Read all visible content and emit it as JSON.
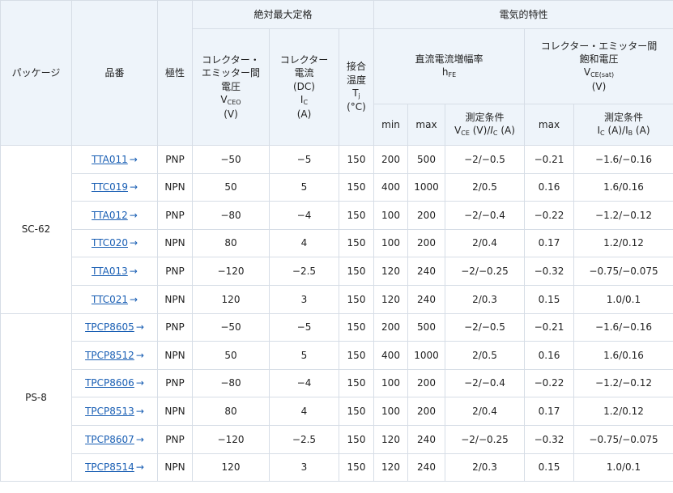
{
  "header": {
    "package": "パッケージ",
    "part": "品番",
    "polarity": "極性",
    "abs_max": "絶対最大定格",
    "elec": "電気的特性",
    "vceo": {
      "l1": "コレクター・",
      "l2": "エミッター間",
      "l3": "電圧",
      "sym": "V",
      "sub": "CEO",
      "unit": "(V)"
    },
    "ic": {
      "l1": "コレクター",
      "l2": "電流",
      "l3": "(DC)",
      "sym": "I",
      "sub": "C",
      "unit": "(A)"
    },
    "tj": {
      "l1": "接合",
      "l2": "温度",
      "sym": "T",
      "sub": "j",
      "unit": "(°C)"
    },
    "hfe": {
      "l1": "直流電流増幅率",
      "sym": "h",
      "sub": "FE"
    },
    "vcesat": {
      "l1": "コレクター・エミッター間",
      "l2": "飽和電圧",
      "sym": "V",
      "sub": "CE(sat)",
      "unit": "(V)"
    },
    "min": "min",
    "max": "max",
    "max2": "max",
    "cond1": {
      "l1": "測定条件",
      "a": "V",
      "asub": "CE",
      "mid": " (V)/",
      "b": "I",
      "bsub": "C",
      "end": " (A)"
    },
    "cond2": {
      "l1": "測定条件",
      "a": "I",
      "asub": "C",
      "mid": " (A)/I",
      "bsub": "B",
      "end": " (A)"
    }
  },
  "arrow": "→",
  "groups": [
    {
      "package": "SC-62",
      "rows": [
        {
          "part": "TTA011",
          "pol": "PNP",
          "vceo": "−50",
          "ic": "−5",
          "tj": "150",
          "hmin": "200",
          "hmax": "500",
          "hcond": "−2/−0.5",
          "vsat": "−0.21",
          "vcond": "−1.6/−0.16"
        },
        {
          "part": "TTC019",
          "pol": "NPN",
          "vceo": "50",
          "ic": "5",
          "tj": "150",
          "hmin": "400",
          "hmax": "1000",
          "hcond": "2/0.5",
          "vsat": "0.16",
          "vcond": "1.6/0.16"
        },
        {
          "part": "TTA012",
          "pol": "PNP",
          "vceo": "−80",
          "ic": "−4",
          "tj": "150",
          "hmin": "100",
          "hmax": "200",
          "hcond": "−2/−0.4",
          "vsat": "−0.22",
          "vcond": "−1.2/−0.12"
        },
        {
          "part": "TTC020",
          "pol": "NPN",
          "vceo": "80",
          "ic": "4",
          "tj": "150",
          "hmin": "100",
          "hmax": "200",
          "hcond": "2/0.4",
          "vsat": "0.17",
          "vcond": "1.2/0.12"
        },
        {
          "part": "TTA013",
          "pol": "PNP",
          "vceo": "−120",
          "ic": "−2.5",
          "tj": "150",
          "hmin": "120",
          "hmax": "240",
          "hcond": "−2/−0.25",
          "vsat": "−0.32",
          "vcond": "−0.75/−0.075"
        },
        {
          "part": "TTC021",
          "pol": "NPN",
          "vceo": "120",
          "ic": "3",
          "tj": "150",
          "hmin": "120",
          "hmax": "240",
          "hcond": "2/0.3",
          "vsat": "0.15",
          "vcond": "1.0/0.1"
        }
      ]
    },
    {
      "package": "PS-8",
      "rows": [
        {
          "part": "TPCP8605",
          "pol": "PNP",
          "vceo": "−50",
          "ic": "−5",
          "tj": "150",
          "hmin": "200",
          "hmax": "500",
          "hcond": "−2/−0.5",
          "vsat": "−0.21",
          "vcond": "−1.6/−0.16"
        },
        {
          "part": "TPCP8512",
          "pol": "NPN",
          "vceo": "50",
          "ic": "5",
          "tj": "150",
          "hmin": "400",
          "hmax": "1000",
          "hcond": "2/0.5",
          "vsat": "0.16",
          "vcond": "1.6/0.16"
        },
        {
          "part": "TPCP8606",
          "pol": "PNP",
          "vceo": "−80",
          "ic": "−4",
          "tj": "150",
          "hmin": "100",
          "hmax": "200",
          "hcond": "−2/−0.4",
          "vsat": "−0.22",
          "vcond": "−1.2/−0.12"
        },
        {
          "part": "TPCP8513",
          "pol": "NPN",
          "vceo": "80",
          "ic": "4",
          "tj": "150",
          "hmin": "100",
          "hmax": "200",
          "hcond": "2/0.4",
          "vsat": "0.17",
          "vcond": "1.2/0.12"
        },
        {
          "part": "TPCP8607",
          "pol": "PNP",
          "vceo": "−120",
          "ic": "−2.5",
          "tj": "150",
          "hmin": "120",
          "hmax": "240",
          "hcond": "−2/−0.25",
          "vsat": "−0.32",
          "vcond": "−0.75/−0.075"
        },
        {
          "part": "TPCP8514",
          "pol": "NPN",
          "vceo": "120",
          "ic": "3",
          "tj": "150",
          "hmin": "120",
          "hmax": "240",
          "hcond": "2/0.3",
          "vsat": "0.15",
          "vcond": "1.0/0.1"
        }
      ]
    }
  ]
}
